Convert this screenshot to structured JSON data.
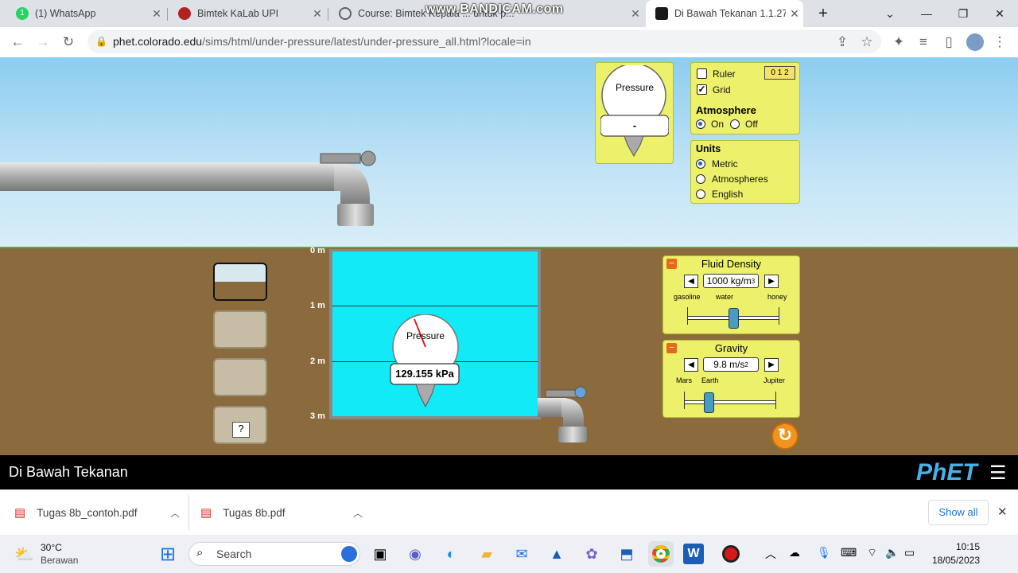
{
  "tabs": [
    {
      "label": "(1) WhatsApp",
      "icon": "whatsapp-icon",
      "color": "#25d366"
    },
    {
      "label": "Bimtek KaLab UPI",
      "icon": "upi-icon",
      "color": "#b22222"
    },
    {
      "label": "Course: Bimtek Kepala ... untuk p...",
      "icon": "globe-icon",
      "color": "#5f6368"
    },
    {
      "label": "Di Bawah Tekanan 1.1.27",
      "icon": "phet-icon",
      "color": "#1a1a1a"
    }
  ],
  "watermark": "www.BANDICAM.com",
  "url": {
    "host": "phet.colorado.edu",
    "path": "/sims/html/under-pressure/latest/under-pressure_all.html?locale=in"
  },
  "gauge_small": {
    "label": "Pressure",
    "value": "-"
  },
  "controls": {
    "ruler": "Ruler",
    "ruler_checked": false,
    "ruler_ticks": "0 1 2",
    "grid": "Grid",
    "grid_checked": true,
    "atmosphere_title": "Atmosphere",
    "on": "On",
    "off": "Off",
    "atmosphere": "On"
  },
  "units": {
    "title": "Units",
    "options": [
      "Metric",
      "Atmospheres",
      "English"
    ],
    "selected": "Metric"
  },
  "depth_labels": [
    "0 m",
    "1 m",
    "2 m",
    "3 m"
  ],
  "gauge_main": {
    "label": "Pressure",
    "value": "129.155 kPa"
  },
  "scenes": [
    "",
    "",
    "",
    "?"
  ],
  "fluid_density": {
    "title": "Fluid Density",
    "value": "1000 kg/m",
    "sup": "3",
    "left": "gasoline",
    "mid": "water",
    "right": "honey",
    "level": 0.5
  },
  "gravity": {
    "title": "Gravity",
    "value": "9.8 m/s",
    "sup": "2",
    "left": "Mars",
    "mid": "Earth",
    "right": "Jupiter",
    "level": 0.27
  },
  "sim_title": "Di Bawah Tekanan",
  "phet_logo": "PhET",
  "downloads": [
    {
      "name": "Tugas 8b_contoh.pdf"
    },
    {
      "name": "Tugas 8b.pdf"
    }
  ],
  "show_all": "Show all",
  "weather": {
    "temp": "30°C",
    "desc": "Berawan"
  },
  "search_placeholder": "Search",
  "clock": {
    "time": "10:15",
    "date": "18/05/2023"
  }
}
